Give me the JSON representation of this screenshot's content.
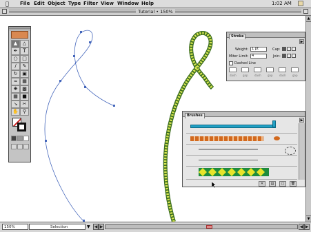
{
  "menubar": {
    "apple": "",
    "items": [
      "File",
      "Edit",
      "Object",
      "Type",
      "Filter",
      "View",
      "Window",
      "Help"
    ],
    "clock": "1:02 AM"
  },
  "document": {
    "title": "Tutorial • 150%"
  },
  "stroke_panel": {
    "tab": "Stroke",
    "weight_label": "Weight:",
    "weight_value": "1 pt",
    "cap_label": "Cap:",
    "miter_label": "Miter Limit:",
    "miter_value": "4",
    "join_label": "Join:",
    "dashed_label": "Dashed Line",
    "dash_labels": [
      "dash",
      "gap",
      "dash",
      "gap",
      "dash",
      "gap"
    ]
  },
  "brushes_panel": {
    "tab": "Brushes"
  },
  "statusbar": {
    "zoom": "150%",
    "mode": "Selection"
  },
  "colors": {
    "path_stroke": "#4466bb",
    "chain_dark": "#3c6e20",
    "chain_light": "#d8e650",
    "brush_teal": "#22a0c4",
    "brush_orange": "#d2691e",
    "brush_green": "#1e8c3c",
    "brush_yellow": "#e8e42a",
    "selection_red": "#cc2222"
  }
}
